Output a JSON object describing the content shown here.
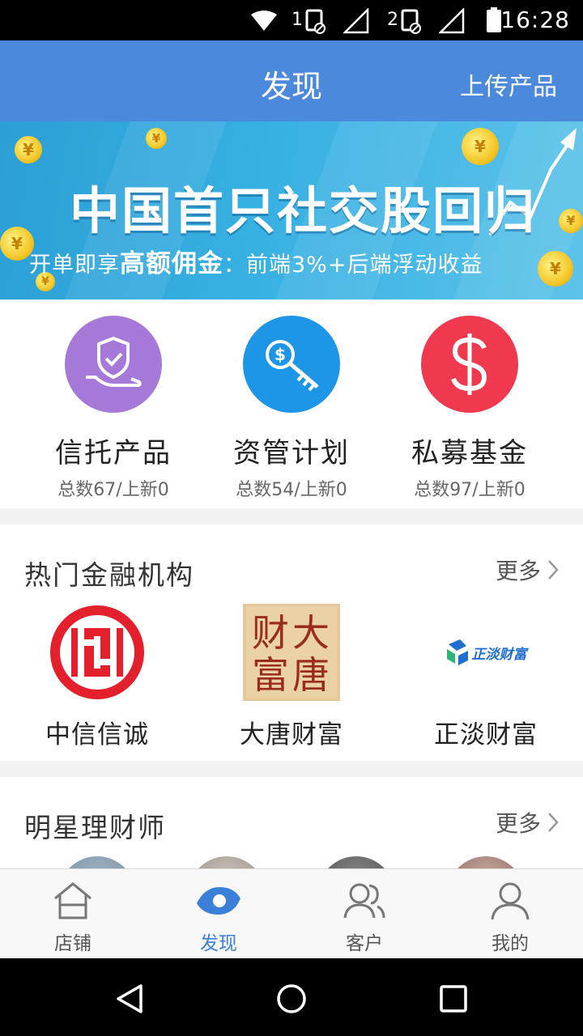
{
  "status_bar": {
    "sim1_label": "1",
    "sim2_label": "2",
    "time": "16:28"
  },
  "header": {
    "title": "发现",
    "upload_label": "上传产品"
  },
  "banner": {
    "title": "中国首只社交股回归",
    "subtitle_prefix": "开单即享",
    "subtitle_highlight": "高额佣金",
    "subtitle_suffix": "：前端3%+后端浮动收益",
    "coin_symbol": "¥",
    "slide_count": 4,
    "active_slide": 0
  },
  "categories": [
    {
      "name": "信托产品",
      "count": "总数67/上新0",
      "icon": "hand-shield-icon",
      "color": "#a678d8"
    },
    {
      "name": "资管计划",
      "count": "总数54/上新0",
      "icon": "key-coin-icon",
      "color": "#1e96e8"
    },
    {
      "name": "私募基金",
      "count": "总数97/上新0",
      "icon": "dollar-icon",
      "color": "#f0394e"
    }
  ],
  "institutions": {
    "title": "热门金融机构",
    "more_label": "更多",
    "items": [
      {
        "name": "中信信诚",
        "logo": "citic-logo",
        "logo_color": "#e3202c"
      },
      {
        "name": "大唐财富",
        "logo": "datang-seal-logo",
        "logo_color": "#9b2a1f",
        "seal_chars": [
          "大",
          "唐",
          "财",
          "富"
        ]
      },
      {
        "name": "正淡财富",
        "logo": "zhengdan-logo",
        "logo_color": "#1f6fd1",
        "logo_text": "正淡财富"
      }
    ]
  },
  "advisors": {
    "title": "明星理财师",
    "more_label": "更多"
  },
  "tabbar": {
    "items": [
      {
        "label": "店铺",
        "icon": "store-icon"
      },
      {
        "label": "发现",
        "icon": "eye-icon",
        "active": true
      },
      {
        "label": "客户",
        "icon": "customers-icon"
      },
      {
        "label": "我的",
        "icon": "profile-icon"
      }
    ]
  },
  "colors": {
    "header_bg": "#4a89dc",
    "active_tab": "#3a7fd8"
  }
}
